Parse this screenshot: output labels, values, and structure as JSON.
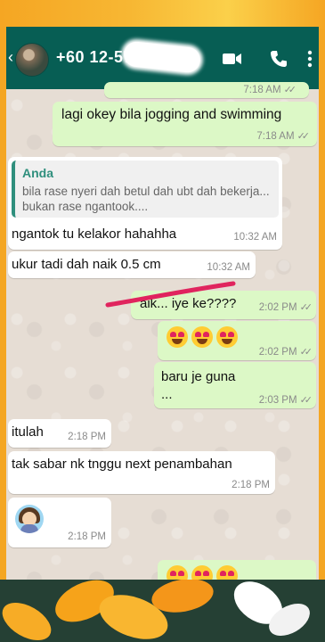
{
  "header": {
    "contact_name": "+60 12-57……20",
    "icons": [
      "back-arrow-icon",
      "avatar",
      "video-call-icon",
      "phone-call-icon",
      "menu-dots-icon"
    ]
  },
  "messages": [
    {
      "id": "m0",
      "type": "out",
      "time": "7:18 AM",
      "partial": true
    },
    {
      "id": "m1",
      "type": "out",
      "text": "lagi okey bila jogging and swimming",
      "time": "7:18 AM"
    },
    {
      "id": "m2",
      "type": "in",
      "quote_author": "Anda",
      "quote_text": "bila rase nyeri dah betul dah ubt dah bekerja... bukan rase ngantook....",
      "text": "ngantok tu kelakor hahahha",
      "time": "10:32 AM"
    },
    {
      "id": "m3",
      "type": "in",
      "text": "ukur tadi dah naik 0.5 cm",
      "time": "10:32 AM"
    },
    {
      "id": "m4",
      "type": "out",
      "text": "aik... iye ke????",
      "time": "2:02 PM"
    },
    {
      "id": "m5",
      "type": "out",
      "emoji": "heart-eyes-emoji x3",
      "time": "2:02 PM"
    },
    {
      "id": "m6",
      "type": "out",
      "text": "baru je guna",
      "text2": "...",
      "time": "2:03 PM"
    },
    {
      "id": "m7",
      "type": "in",
      "text": "itulah",
      "time": "2:18 PM"
    },
    {
      "id": "m8",
      "type": "in",
      "text": "tak sabar nk tnggu next penambahan",
      "time": "2:18 PM"
    },
    {
      "id": "m9",
      "type": "in",
      "sticker": "person-gesturing-emoji",
      "time": "2:18 PM"
    },
    {
      "id": "m10",
      "type": "out",
      "emoji": "grinning-emoji partial",
      "partial": true
    }
  ],
  "ticks": "✓✓",
  "colors": {
    "header": "#075e54",
    "outgoing_bubble": "#dcf8c6",
    "incoming_bubble": "#ffffff",
    "quote_accent": "#2f8f7d",
    "annotation_stroke": "#e0245e",
    "frame": "#f4a623"
  }
}
